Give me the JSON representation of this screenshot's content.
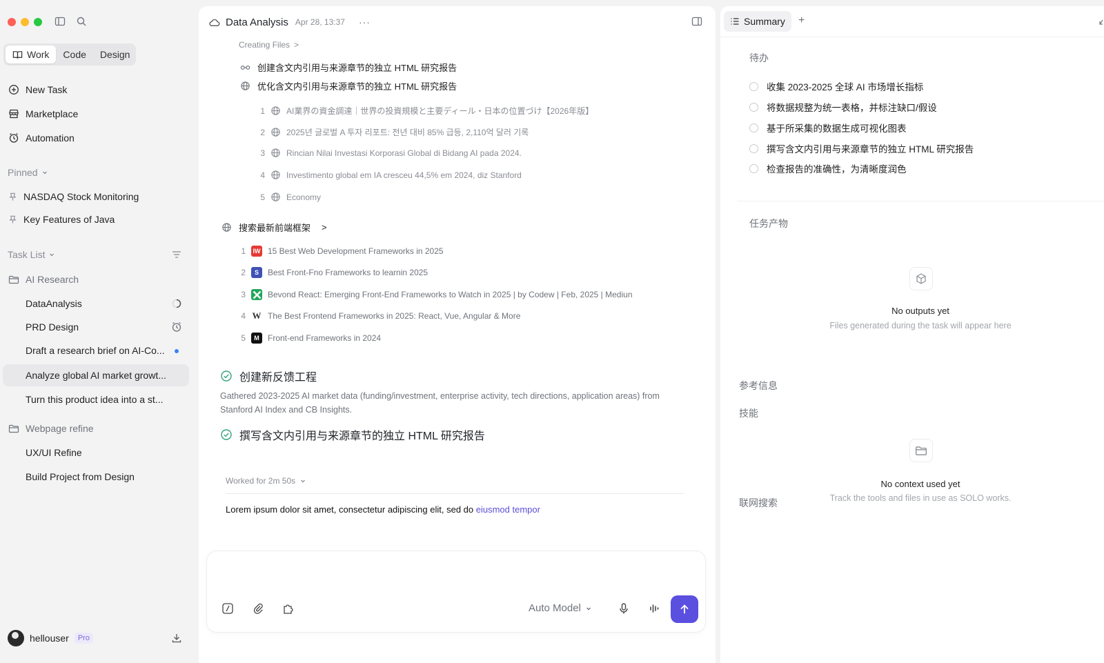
{
  "sidebar": {
    "modes": [
      "Work",
      "Code",
      "Design"
    ],
    "nav": [
      "New Task",
      "Marketplace",
      "Automation"
    ],
    "pinned_label": "Pinned",
    "pinned": [
      "NASDAQ Stock Monitoring",
      "Key Features of Java"
    ],
    "tasklist_label": "Task List",
    "folder1": "AI Research",
    "tasks1": [
      "DataAnalysis",
      "PRD Design",
      "Draft a research brief on AI-Co...",
      "Analyze global AI market growt...",
      "Turn this product idea into a st..."
    ],
    "folder2": "Webpage refine",
    "tasks2": [
      "UX/UI Refine",
      "Build Project from Design"
    ],
    "user": "hellouser",
    "badge": "Pro"
  },
  "main": {
    "title": "Data Analysis",
    "date": "Apr 28, 13:37",
    "more": "···",
    "crumb": "Creating Files",
    "crumb_arrow": ">",
    "step1": "创建含文内引用与来源章节的独立 HTML 研究报告",
    "step2": "优化含文内引用与来源章节的独立 HTML 研究报告",
    "sources1": [
      {
        "n": "1",
        "t": "AI業界の資金調達｜世界の投資規模と主要ディール・日本の位置づけ【2026年版】"
      },
      {
        "n": "2",
        "t": "2025년 글로벌 A 투자 리포트: 전년 대비 85% 급등, 2,110억 달러 기록"
      },
      {
        "n": "3",
        "t": "Rincian Nilai Investasi Korporasi Global di Bidang AI pada 2024."
      },
      {
        "n": "4",
        "t": "Investimento global em IA cresceu 44,5% em 2024, diz Stanford"
      },
      {
        "n": "5",
        "t": "Economy"
      }
    ],
    "search_step": "搜索最新前端框架",
    "search_arrow": ">",
    "sources2": [
      {
        "n": "1",
        "fav": "IW",
        "t": "15 Best Web Development Frameworks in 2025"
      },
      {
        "n": "2",
        "fav": "S",
        "t": "Best Front-Fno Frameworks to learnin 2025"
      },
      {
        "n": "3",
        "fav": "",
        "t": "Bevond React: Emerging Front-End Frameworks to Watch in 2025 | by Codew | Feb, 2025 | Mediun"
      },
      {
        "n": "4",
        "fav": "W",
        "t": "The Best Frontend Frameworks in 2025: React, Vue, Angular & More"
      },
      {
        "n": "5",
        "fav": "M",
        "t": "Front-end Frameworks in 2024"
      }
    ],
    "done1": "创建新反馈工程",
    "summary": "Gathered 2023-2025 AI market data (funding/investment, enterprise activity, tech directions, application areas) from Stanford AI Index and CB Insights.",
    "done2": "撰写含文内引用与来源章节的独立 HTML 研究报告",
    "worked": "Worked for 2m 50s",
    "lorem_plain": "Lorem ipsum dolor sit amet, consectetur adipiscing elit, sed do ",
    "lorem_link": "eiusmod tempor",
    "model": "Auto Model"
  },
  "right": {
    "tab": "Summary",
    "add": "+",
    "todo_label": "待办",
    "todos": [
      "收集 2023-2025 全球 AI 市场增长指标",
      "将数据规整为统一表格，并标注缺口/假设",
      "基于所采集的数据生成可视化图表",
      "撰写含文内引用与来源章节的独立 HTML 研究报告",
      "检查报告的准确性，为清晰度润色"
    ],
    "outputs_label": "任务产物",
    "outputs_empty_title": "No outputs yet",
    "outputs_empty_sub": "Files generated during the task will appear here",
    "ref_label": "参考信息",
    "skills_label": "技能",
    "web_label": "联网搜索",
    "ctx_empty_title": "No context used yet",
    "ctx_empty_sub": "Track the tools and files in use as SOLO works."
  },
  "colors": {
    "accent": "#5b4fe0",
    "link": "#5b4fd9",
    "success": "#34a37a"
  }
}
